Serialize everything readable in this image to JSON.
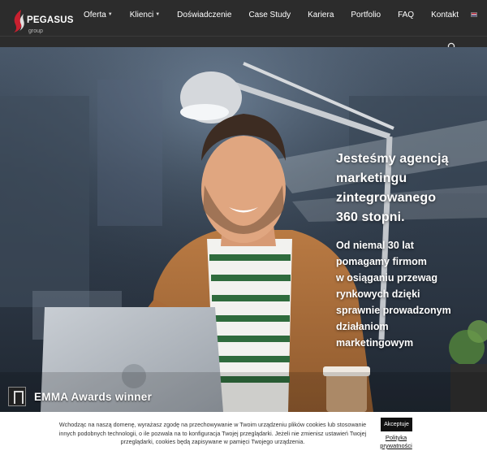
{
  "brand": {
    "name": "PEGASUS",
    "sub": "group",
    "accent": "#c8202f"
  },
  "nav": {
    "items": [
      {
        "label": "Oferta",
        "dropdown": true
      },
      {
        "label": "Klienci",
        "dropdown": true
      },
      {
        "label": "Doświadczenie",
        "dropdown": false
      },
      {
        "label": "Case Study",
        "dropdown": false
      },
      {
        "label": "Kariera",
        "dropdown": false
      },
      {
        "label": "Portfolio",
        "dropdown": false
      },
      {
        "label": "FAQ",
        "dropdown": false
      },
      {
        "label": "Kontakt",
        "dropdown": false
      }
    ],
    "caret": "⌄",
    "language_icon": "uk-flag-icon"
  },
  "search": {
    "icon": "search-icon"
  },
  "hero": {
    "headline": [
      "Jesteśmy agencją",
      "marketingu",
      "zintegrowanego",
      "360 stopni."
    ],
    "sub": [
      "Od niemal 30 lat",
      "pomagamy firmom",
      "w osiąganiu przewag",
      "rynkowych dzięki",
      "sprawnie prowadzonym",
      "działaniom",
      "marketingowym"
    ]
  },
  "award": {
    "title": "EMMA Awards winner"
  },
  "cookie": {
    "text": "Wchodząc na naszą domenę, wyrażasz zgodę na przechowywanie w Twoim urządzeniu plików cookies lub stosowanie innych podobnych technologii, o ile pozwala na to konfiguracja Twojej przeglądarki. Jeżeli nie zmienisz ustawień Twojej przeglądarki, cookies będą zapisywane w pamięci Twojego urządzenia.",
    "accept_label": "Akceptuje",
    "privacy_label": "Polityka prywatności"
  },
  "colors": {
    "header_bg": "#2c2c2c",
    "hero_text": "#ffffff",
    "cookie_bg": "#ffffff",
    "button_bg": "#111111"
  }
}
